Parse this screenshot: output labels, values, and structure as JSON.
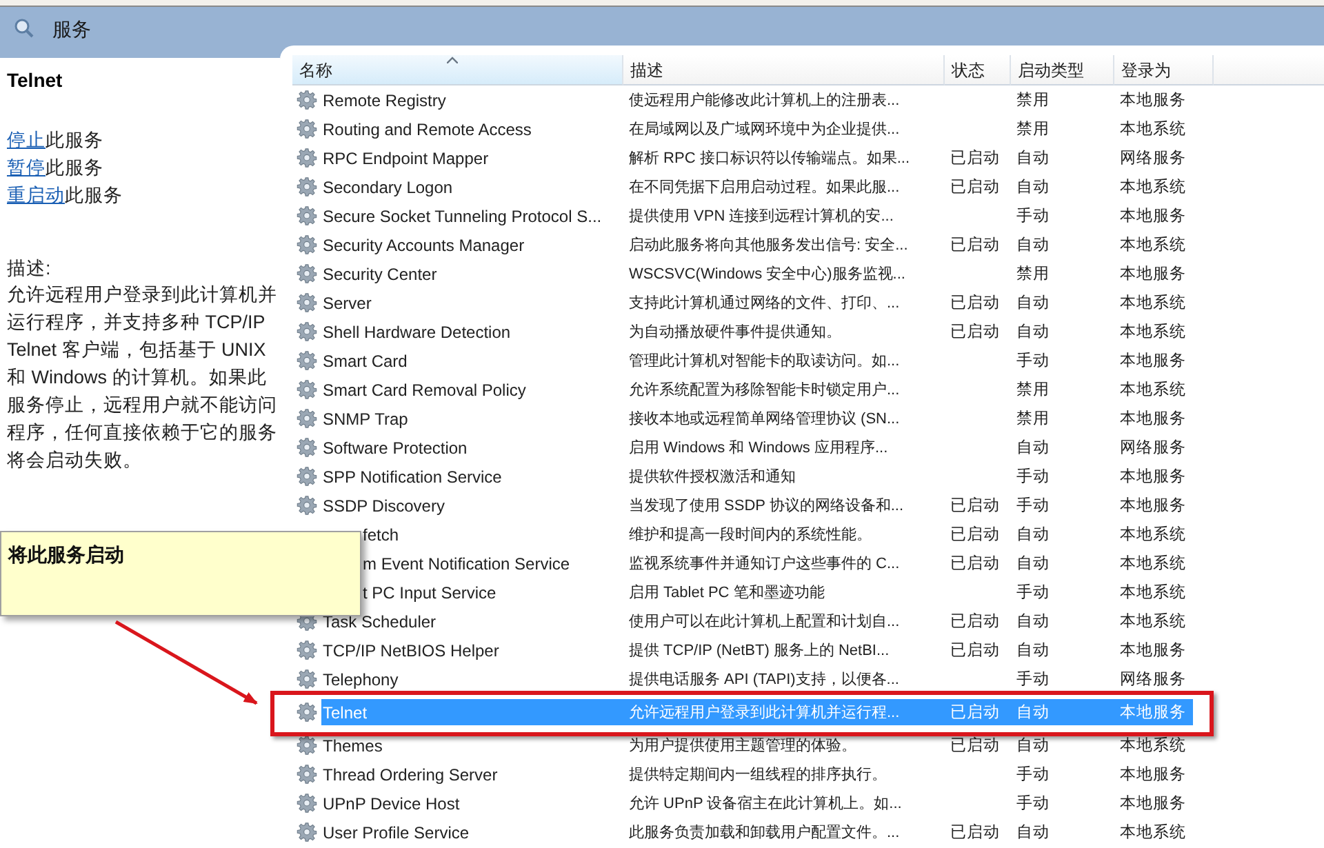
{
  "window": {
    "title": "服务"
  },
  "details": {
    "title": "Telnet",
    "actions": [
      {
        "link": "停止",
        "text": "此服务"
      },
      {
        "link": "暂停",
        "text": "此服务"
      },
      {
        "link": "重启动",
        "text": "此服务"
      }
    ],
    "description_label": "描述:",
    "description": "允许远程用户登录到此计算机并运行程序，并支持多种 TCP/IP Telnet 客户端，包括基于 UNIX 和 Windows 的计算机。如果此服务停止，远程用户就不能访问程序，任何直接依赖于它的服务将会启动失败。"
  },
  "table": {
    "columns": [
      "名称",
      "描述",
      "状态",
      "启动类型",
      "登录为"
    ],
    "rows": [
      {
        "name": "Remote Registry",
        "description": "使远程用户能修改此计算机上的注册表...",
        "status": "",
        "startup": "禁用",
        "logon": "本地服务",
        "selected": false,
        "kind": "plain"
      },
      {
        "name": "Routing and Remote Access",
        "description": "在局域网以及广域网环境中为企业提供...",
        "status": "",
        "startup": "禁用",
        "logon": "本地系统",
        "selected": false,
        "kind": "plain"
      },
      {
        "name": "RPC Endpoint Mapper",
        "description": "解析 RPC 接口标识符以传输端点。如果...",
        "status": "已启动",
        "startup": "自动",
        "logon": "网络服务",
        "selected": false,
        "kind": "plain"
      },
      {
        "name": "Secondary Logon",
        "description": "在不同凭据下启用启动过程。如果此服...",
        "status": "已启动",
        "startup": "自动",
        "logon": "本地系统",
        "selected": false,
        "kind": "plain"
      },
      {
        "name": "Secure Socket Tunneling Protocol S...",
        "description": "提供使用 VPN 连接到远程计算机的安...",
        "status": "",
        "startup": "手动",
        "logon": "本地服务",
        "selected": false,
        "kind": "plain"
      },
      {
        "name": "Security Accounts Manager",
        "description": "启动此服务将向其他服务发出信号: 安全...",
        "status": "已启动",
        "startup": "自动",
        "logon": "本地系统",
        "selected": false,
        "kind": "plain"
      },
      {
        "name": "Security Center",
        "description": "WSCSVC(Windows 安全中心)服务监视...",
        "status": "",
        "startup": "禁用",
        "logon": "本地服务",
        "selected": false,
        "kind": "plain"
      },
      {
        "name": "Server",
        "description": "支持此计算机通过网络的文件、打印、...",
        "status": "已启动",
        "startup": "自动",
        "logon": "本地系统",
        "selected": false,
        "kind": "plain"
      },
      {
        "name": "Shell Hardware Detection",
        "description": "为自动播放硬件事件提供通知。",
        "status": "已启动",
        "startup": "自动",
        "logon": "本地系统",
        "selected": false,
        "kind": "plain"
      },
      {
        "name": "Smart Card",
        "description": "管理此计算机对智能卡的取读访问。如...",
        "status": "",
        "startup": "手动",
        "logon": "本地服务",
        "selected": false,
        "kind": "plain"
      },
      {
        "name": "Smart Card Removal Policy",
        "description": "允许系统配置为移除智能卡时锁定用户...",
        "status": "",
        "startup": "禁用",
        "logon": "本地系统",
        "selected": false,
        "kind": "plain"
      },
      {
        "name": "SNMP Trap",
        "description": "接收本地或远程简单网络管理协议 (SN...",
        "status": "",
        "startup": "禁用",
        "logon": "本地服务",
        "selected": false,
        "kind": "plain"
      },
      {
        "name": "Software Protection",
        "description": "启用 Windows 和 Windows 应用程序...",
        "status": "",
        "startup": "自动",
        "logon": "网络服务",
        "selected": false,
        "kind": "plain"
      },
      {
        "name": "SPP Notification Service",
        "description": "提供软件授权激活和通知",
        "status": "",
        "startup": "手动",
        "logon": "本地服务",
        "selected": false,
        "kind": "plain"
      },
      {
        "name": "SSDP Discovery",
        "description": "当发现了使用 SSDP 协议的网络设备和...",
        "status": "已启动",
        "startup": "手动",
        "logon": "本地服务",
        "selected": false,
        "kind": "plain"
      },
      {
        "name": "fetch",
        "description": "维护和提高一段时间内的系统性能。",
        "status": "已启动",
        "startup": "自动",
        "logon": "本地系统",
        "selected": false,
        "kind": "covered"
      },
      {
        "name": "m Event Notification Service",
        "description": "监视系统事件并通知订户这些事件的 C...",
        "status": "已启动",
        "startup": "自动",
        "logon": "本地系统",
        "selected": false,
        "kind": "covered"
      },
      {
        "name": "t PC Input Service",
        "description": "启用 Tablet PC 笔和墨迹功能",
        "status": "",
        "startup": "手动",
        "logon": "本地系统",
        "selected": false,
        "kind": "covered"
      },
      {
        "name": "Task Scheduler",
        "description": "使用户可以在此计算机上配置和计划自...",
        "status": "已启动",
        "startup": "自动",
        "logon": "本地系统",
        "selected": false,
        "kind": "plain"
      },
      {
        "name": "TCP/IP NetBIOS Helper",
        "description": "提供 TCP/IP (NetBT) 服务上的 NetBI...",
        "status": "已启动",
        "startup": "自动",
        "logon": "本地服务",
        "selected": false,
        "kind": "plain"
      },
      {
        "name": "Telephony",
        "description": "提供电话服务 API (TAPI)支持，以便各...",
        "status": "",
        "startup": "手动",
        "logon": "网络服务",
        "selected": false,
        "kind": "plain"
      },
      {
        "name": "Telnet",
        "description": "允许远程用户登录到此计算机并运行程...",
        "status": "已启动",
        "startup": "自动",
        "logon": "本地服务",
        "selected": true,
        "kind": "plain"
      },
      {
        "name": "Themes",
        "description": "为用户提供使用主题管理的体验。",
        "status": "已启动",
        "startup": "自动",
        "logon": "本地系统",
        "selected": false,
        "kind": "plain"
      },
      {
        "name": "Thread Ordering Server",
        "description": "提供特定期间内一组线程的排序执行。",
        "status": "",
        "startup": "手动",
        "logon": "本地服务",
        "selected": false,
        "kind": "plain"
      },
      {
        "name": "UPnP Device Host",
        "description": "允许 UPnP 设备宿主在此计算机上。如...",
        "status": "",
        "startup": "手动",
        "logon": "本地服务",
        "selected": false,
        "kind": "plain"
      },
      {
        "name": "User Profile Service",
        "description": "此服务负责加载和卸载用户配置文件。...",
        "status": "已启动",
        "startup": "自动",
        "logon": "本地系统",
        "selected": false,
        "kind": "plain"
      }
    ]
  },
  "callout": {
    "text": "将此服务启动"
  }
}
